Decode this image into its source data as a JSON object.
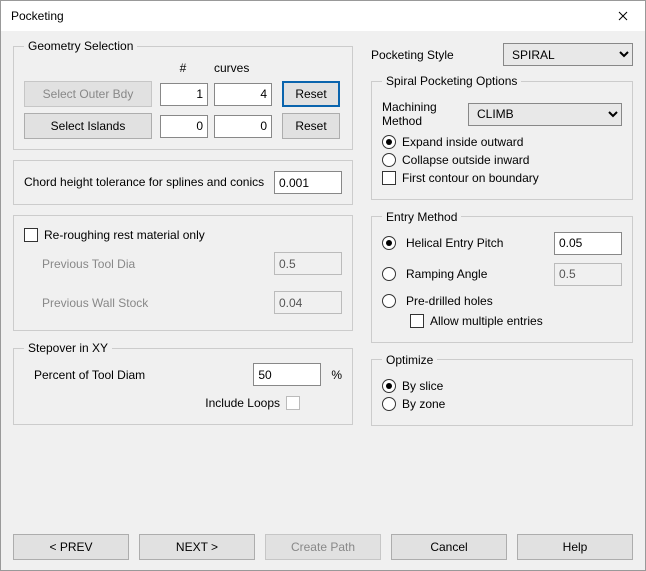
{
  "title": "Pocketing",
  "geometry": {
    "legend": "Geometry Selection",
    "hdr_num": "#",
    "hdr_curves": "curves",
    "select_outer": "Select Outer Bdy",
    "outer_num": "1",
    "outer_curves": "4",
    "reset1": "Reset",
    "select_islands": "Select Islands",
    "islands_num": "0",
    "islands_curves": "0",
    "reset2": "Reset"
  },
  "chord": {
    "label": "Chord height tolerance for splines and conics",
    "value": "0.001"
  },
  "rerough": {
    "label": "Re-roughing rest material only",
    "prev_dia_label": "Previous Tool Dia",
    "prev_dia": "0.5",
    "prev_wall_label": "Previous Wall Stock",
    "prev_wall": "0.04"
  },
  "stepover": {
    "legend": "Stepover in  XY",
    "percent_label": "Percent of Tool Diam",
    "percent_value": "50",
    "percent_unit": "%",
    "include_loops": "Include Loops"
  },
  "style": {
    "label": "Pocketing Style",
    "value": "SPIRAL"
  },
  "spiral": {
    "legend": "Spiral Pocketing Options",
    "method_label": "Machining Method",
    "method_value": "CLIMB",
    "expand": "Expand inside outward",
    "collapse": "Collapse outside inward",
    "first_contour": "First contour on boundary"
  },
  "entry": {
    "legend": "Entry Method",
    "helical": "Helical Entry Pitch",
    "helical_value": "0.05",
    "ramping": "Ramping Angle",
    "ramping_value": "0.5",
    "predrilled": "Pre-drilled holes",
    "allow_multiple": "Allow multiple entries"
  },
  "optimize": {
    "legend": "Optimize",
    "by_slice": "By slice",
    "by_zone": "By zone"
  },
  "buttons": {
    "prev": "< PREV",
    "next": "NEXT >",
    "create": "Create Path",
    "cancel": "Cancel",
    "help": "Help"
  }
}
